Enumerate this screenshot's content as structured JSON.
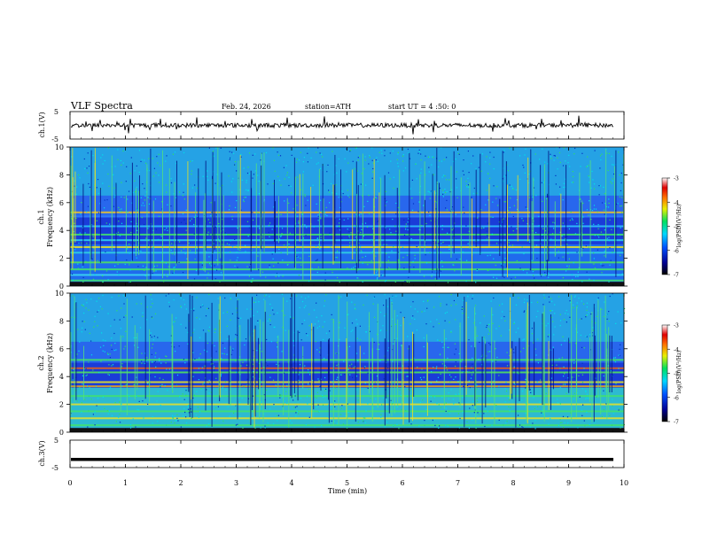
{
  "header": {
    "title": "VLF Spectra",
    "date": "Feb. 24, 2026",
    "station": "station=ATH",
    "start": "start UT =  4 :50: 0"
  },
  "chart_data": [
    {
      "type": "line",
      "panel": "ch1-waveform",
      "ylabel": "ch.1(V)",
      "ylim": [
        -5,
        5
      ],
      "yticks": [
        "5",
        "-5"
      ],
      "baseline_value": 0,
      "description_values": "noisy waveform near 0 V with spikes to about +2 V"
    },
    {
      "type": "heatmap",
      "panel": "ch1-spectrogram",
      "ylabel_top": "ch.1",
      "ylabel": "Frequency (kHz)",
      "ylim": [
        0,
        10
      ],
      "yticks": [
        "0",
        "2",
        "4",
        "6",
        "8",
        "10"
      ],
      "xlim": [
        0,
        10
      ],
      "colorbar": {
        "label": "log(PSD)(V²/Hz)",
        "range": [
          -7,
          -3
        ],
        "ticks": [
          "-3",
          "-4",
          "-5",
          "-6",
          "-7"
        ]
      },
      "bands_khz": [
        0.4,
        0.8,
        1.2,
        1.7,
        2.4,
        2.8,
        3.3,
        3.7,
        4.3,
        5.0,
        5.3
      ]
    },
    {
      "type": "heatmap",
      "panel": "ch2-spectrogram",
      "ylabel_top": "ch.2",
      "ylabel": "Frequency (kHz)",
      "ylim": [
        0,
        10
      ],
      "yticks": [
        "0",
        "2",
        "4",
        "6",
        "8",
        "10"
      ],
      "xlim": [
        0,
        10
      ],
      "colorbar": {
        "label": "log(PSD)(V²/Hz)",
        "range": [
          -7,
          -3
        ],
        "ticks": [
          "-3",
          "-4",
          "-5",
          "-6",
          "-7"
        ]
      },
      "bands_khz": [
        0.5,
        1.0,
        1.5,
        2.0,
        2.6,
        3.3,
        3.6,
        4.3,
        4.6,
        5.2
      ]
    },
    {
      "type": "line",
      "panel": "ch3-waveform",
      "ylabel": "ch.3(V)",
      "ylim": [
        -5,
        5
      ],
      "yticks": [
        "5",
        "-5"
      ],
      "baseline_value": -2
    }
  ],
  "xaxis": {
    "label": "Time (min)",
    "ticks": [
      "0",
      "1",
      "2",
      "3",
      "4",
      "5",
      "6",
      "7",
      "8",
      "9",
      "10"
    ]
  }
}
